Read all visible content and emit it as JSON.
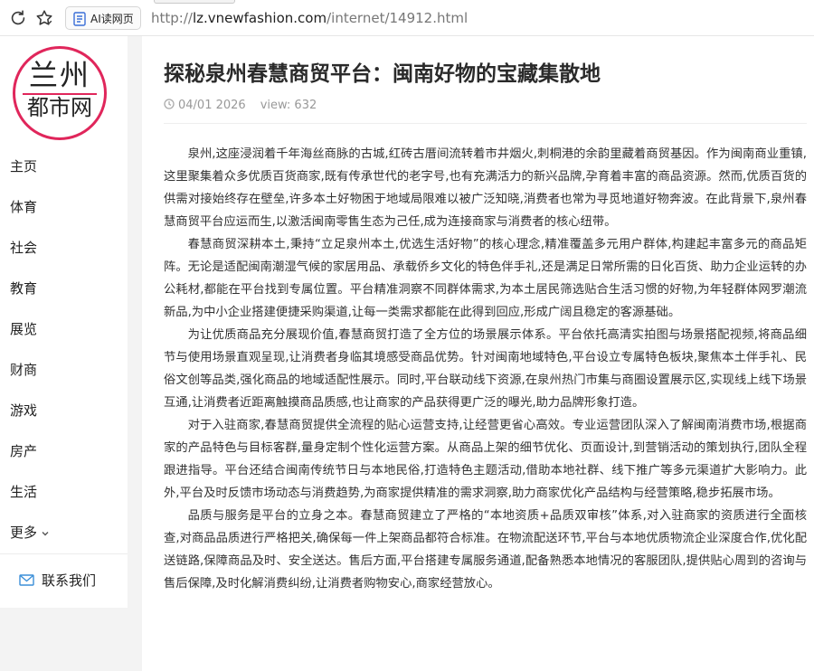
{
  "browser": {
    "ai_button_label": "AI读网页",
    "url_prefix": "http://",
    "url_host": "lz.vnewfashion.com",
    "url_path": "/internet/14912.html"
  },
  "site": {
    "logo_top": "兰州",
    "logo_bottom": "都市网"
  },
  "nav": {
    "items": [
      "主页",
      "体育",
      "社会",
      "教育",
      "展览",
      "财商",
      "游戏",
      "房产",
      "生活"
    ],
    "more_label": "更多",
    "contact_label": "联系我们"
  },
  "article": {
    "title": "探秘泉州春慧商贸平台：闽南好物的宝藏集散地",
    "date": "04/01 2026",
    "views": "view: 632",
    "paragraphs": [
      "泉州,这座浸润着千年海丝商脉的古城,红砖古厝间流转着市井烟火,刺桐港的余韵里藏着商贸基因。作为闽南商业重镇,这里聚集着众多优质百货商家,既有传承世代的老字号,也有充满活力的新兴品牌,孕育着丰富的商品资源。然而,优质百货的供需对接始终存在壁垒,许多本土好物困于地域局限难以被广泛知晓,消费者也常为寻觅地道好物奔波。在此背景下,泉州春慧商贸平台应运而生,以激活闽南零售生态为己任,成为连接商家与消费者的核心纽带。",
      "春慧商贸深耕本土,秉持“立足泉州本土,优选生活好物”的核心理念,精准覆盖多元用户群体,构建起丰富多元的商品矩阵。无论是适配闽南潮湿气候的家居用品、承载侨乡文化的特色伴手礼,还是满足日常所需的日化百货、助力企业运转的办公耗材,都能在平台找到专属位置。平台精准洞察不同群体需求,为本土居民筛选贴合生活习惯的好物,为年轻群体网罗潮流新品,为中小企业搭建便捷采购渠道,让每一类需求都能在此得到回应,形成广阔且稳定的客源基础。",
      "为让优质商品充分展现价值,春慧商贸打造了全方位的场景展示体系。平台依托高清实拍图与场景搭配视频,将商品细节与使用场景直观呈现,让消费者身临其境感受商品优势。针对闽南地域特色,平台设立专属特色板块,聚焦本土伴手礼、民俗文创等品类,强化商品的地域适配性展示。同时,平台联动线下资源,在泉州热门市集与商圈设置展示区,实现线上线下场景互通,让消费者近距离触摸商品质感,也让商家的产品获得更广泛的曝光,助力品牌形象打造。",
      "对于入驻商家,春慧商贸提供全流程的贴心运营支持,让经营更省心高效。专业运营团队深入了解闽南消费市场,根据商家的产品特色与目标客群,量身定制个性化运营方案。从商品上架的细节优化、页面设计,到营销活动的策划执行,团队全程跟进指导。平台还结合闽南传统节日与本地民俗,打造特色主题活动,借助本地社群、线下推广等多元渠道扩大影响力。此外,平台及时反馈市场动态与消费趋势,为商家提供精准的需求洞察,助力商家优化产品结构与经营策略,稳步拓展市场。",
      "品质与服务是平台的立身之本。春慧商贸建立了严格的“本地资质+品质双审核”体系,对入驻商家的资质进行全面核查,对商品品质进行严格把关,确保每一件上架商品都符合标准。在物流配送环节,平台与本地优质物流企业深度合作,优化配送链路,保障商品及时、安全送达。售后方面,平台搭建专属服务通道,配备熟悉本地情况的客服团队,提供贴心周到的咨询与售后保障,及时化解消费纠纷,让消费者购物安心,商家经营放心。"
    ]
  }
}
